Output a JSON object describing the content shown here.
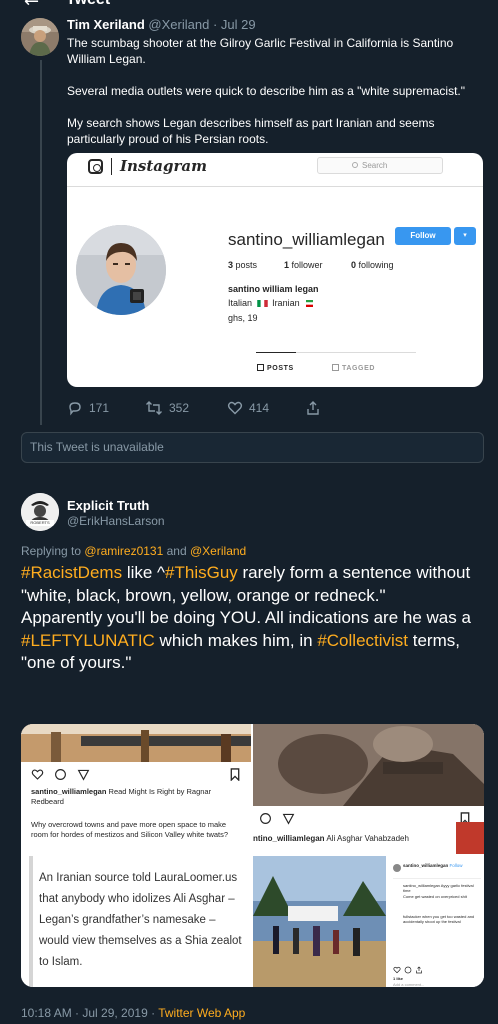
{
  "header": {
    "title": "Tweet"
  },
  "tweet1": {
    "name": "Tim Xeriland",
    "handle": "@Xeriland",
    "date": "Jul 29",
    "paragraphs": [
      "The scumbag shooter at the Gilroy Garlic Festival in California is Santino William Legan.",
      "Several media outlets were quick to describe him as a \"white supremacist.\"",
      "My search shows Legan describes himself as part Iranian and seems particularly proud of his Persian roots."
    ],
    "replies": "171",
    "retweets": "352",
    "likes": "414"
  },
  "instagram": {
    "wordmark": "Instagram",
    "search_placeholder": "Search",
    "username": "santino_williamlegan",
    "follow_label": "Follow",
    "dropdown_label": "▾",
    "posts_count": "3",
    "posts_label": "posts",
    "followers_count": "1",
    "followers_label": "follower",
    "following_count": "0",
    "following_label": "following",
    "full_name": "santino william legan",
    "bio_italian": "Italian",
    "bio_iranian": "Iranian",
    "bio_line2": "ghs, 19",
    "tab_posts": "POSTS",
    "tab_tagged": "TAGGED"
  },
  "unavailable_text": "This Tweet is unavailable",
  "tweet2": {
    "name": "Explicit Truth",
    "handle": "@ErikHansLarson",
    "avatar_text": "ROBERTS",
    "replying_prefix": "Replying to",
    "replying_user1": "@ramirez0131",
    "replying_and": "and",
    "replying_user2": "@Xeriland",
    "hashtag1": "#RacistDems",
    "text1": " like ^",
    "hashtag2": "#ThisGuy",
    "text2": " rarely form a sentence without \"white, black, brown, yellow, orange or redneck.\"",
    "text3": "Apparently you'll be doing YOU.  All indications are he was a ",
    "hashtag3": "#LEFTYLUNATIC",
    "text4": " which makes him, in ",
    "hashtag4": "#Collectivist",
    "text5": " terms, \"one of yours.\"",
    "timestamp": "10:18 AM · Jul 29, 2019",
    "separator": " · ",
    "app": "Twitter Web App"
  },
  "grid": {
    "cell1_user": "santino_williamlegan",
    "cell1_caption": "Read Might Is Right by Ragnar Redbeard",
    "cell1_text": "Why overcrowd towns and pave more open space to make room for hordes of mestizos and Silicon Valley white twats?",
    "cell2_user": "ntino_williamlegan",
    "cell2_caption": "Ali Asghar Vahabzadeh",
    "cell3_text": "An Iranian source told LauraLoomer.us that anybody who idolizes Ali Asghar – Legan’s grandfather’s namesake – would view themselves as a Shia zealot to Islam.",
    "cell4_user": "santino_williamlegan",
    "cell4_follow": "Follow",
    "cell4_line1": "santino_williamlegan Ayyy garlic festival time",
    "cell4_line2": "Come get wasted on overpriced shit",
    "cell4_line3": "fullstacker when you get too wasted and accidentally shoot up the festival",
    "cell4_likes": "1 like",
    "cell4_comment": "Add a comment..."
  },
  "colors": {
    "background": "#15202b",
    "muted": "#8899a6",
    "accent": "#ffad1f",
    "border": "#38444d",
    "instagram_blue": "#3897f0"
  }
}
